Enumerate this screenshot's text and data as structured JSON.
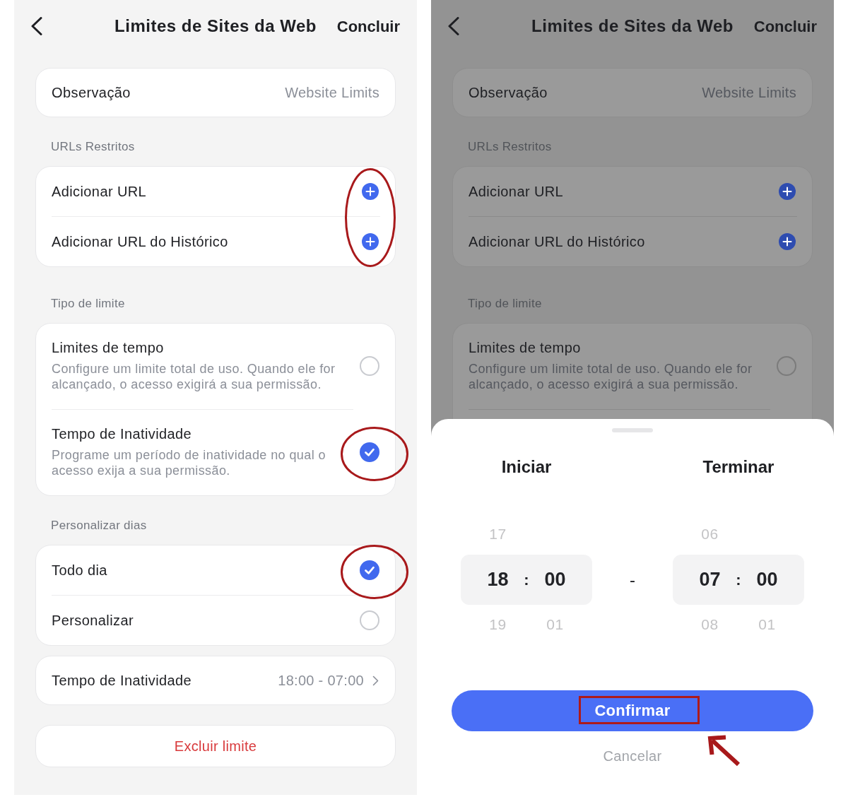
{
  "screens": [
    {
      "dimmed": false,
      "header": {
        "title": "Limites de Sites da Web",
        "done_button": "Concluir"
      },
      "note": {
        "label": "Observação",
        "value": "Website Limits"
      },
      "sections": [
        {
          "kind": "actions",
          "title": "URLs Restritos",
          "circled": true,
          "items": [
            {
              "label": "Adicionar URL"
            },
            {
              "label": "Adicionar URL do Histórico"
            }
          ]
        },
        {
          "kind": "choices",
          "title": "Tipo de limite",
          "items": [
            {
              "label": "Limites de tempo",
              "description": "Configure um limite total de uso. Quando ele for alcançado, o acesso exigirá a sua permissão.",
              "selected": false,
              "circled": false
            },
            {
              "label": "Tempo de Inatividade",
              "description": "Programe um período de inatividade no qual o acesso exija a sua permissão.",
              "selected": true,
              "circled": true
            }
          ]
        },
        {
          "kind": "choices",
          "title": "Personalizar dias",
          "items": [
            {
              "label": "Todo dia",
              "selected": true,
              "circled": true
            },
            {
              "label": "Personalizar",
              "selected": false,
              "circled": false
            }
          ]
        }
      ],
      "idle_row": {
        "label": "Tempo de Inatividade",
        "value": "18:00 - 07:00"
      },
      "delete_button": "Excluir limite"
    },
    {
      "dimmed": true,
      "header": {
        "title": "Limites de Sites da Web",
        "done_button": "Concluir"
      },
      "note": {
        "label": "Observação",
        "value": "Website Limits"
      },
      "sections": [
        {
          "kind": "actions",
          "title": "URLs Restritos",
          "circled": false,
          "items": [
            {
              "label": "Adicionar URL"
            },
            {
              "label": "Adicionar URL do Histórico"
            }
          ]
        },
        {
          "kind": "choices",
          "title": "Tipo de limite",
          "truncated": true,
          "items": [
            {
              "label": "Limites de tempo",
              "description": "Configure um limite total de uso. Quando ele for alcançado, o acesso exigirá a sua permissão.",
              "selected": false,
              "circled": false
            }
          ]
        }
      ],
      "time_sheet": {
        "pickers": [
          {
            "title": "Iniciar",
            "hour": {
              "above": "17",
              "value": "18",
              "below": "19"
            },
            "separator": ":",
            "minute": {
              "value": "00",
              "below": "01"
            }
          },
          {
            "title": "Terminar",
            "hour": {
              "above": "06",
              "value": "07",
              "below": "08"
            },
            "separator": ":",
            "minute": {
              "value": "00",
              "below": "01"
            }
          }
        ],
        "range_separator": "-",
        "confirm_button": {
          "label": "Confirmar",
          "framed": true,
          "arrow": true
        },
        "cancel_button": {
          "label": "Cancelar"
        }
      }
    }
  ]
}
